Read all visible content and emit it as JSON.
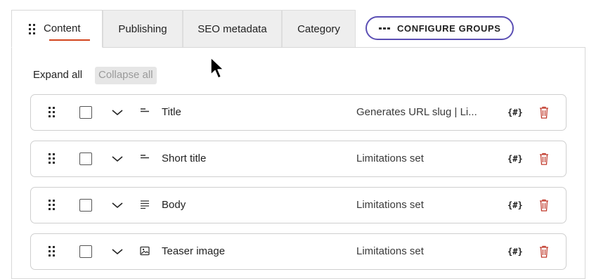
{
  "tabs": [
    {
      "label": "Content",
      "active": true
    },
    {
      "label": "Publishing",
      "active": false
    },
    {
      "label": "SEO metadata",
      "active": false
    },
    {
      "label": "Category",
      "active": false
    }
  ],
  "configure_button": {
    "label": "CONFIGURE GROUPS",
    "icon": "dots-icon"
  },
  "toolbar": {
    "expand_all": "Expand all",
    "collapse_all": "Collapse all"
  },
  "fields": [
    {
      "name": "Title",
      "type_icon": "short-text-icon",
      "summary": "Generates URL slug | Li...",
      "checked": false
    },
    {
      "name": "Short title",
      "type_icon": "short-text-icon",
      "summary": "Limitations set",
      "checked": false
    },
    {
      "name": "Body",
      "type_icon": "long-text-icon",
      "summary": "Limitations set",
      "checked": false
    },
    {
      "name": "Teaser image",
      "type_icon": "image-icon",
      "summary": "Limitations set",
      "checked": false
    }
  ],
  "colors": {
    "accent_underline": "#d2451e",
    "button_border": "#5b4fb4",
    "delete_icon": "#c0392b"
  }
}
